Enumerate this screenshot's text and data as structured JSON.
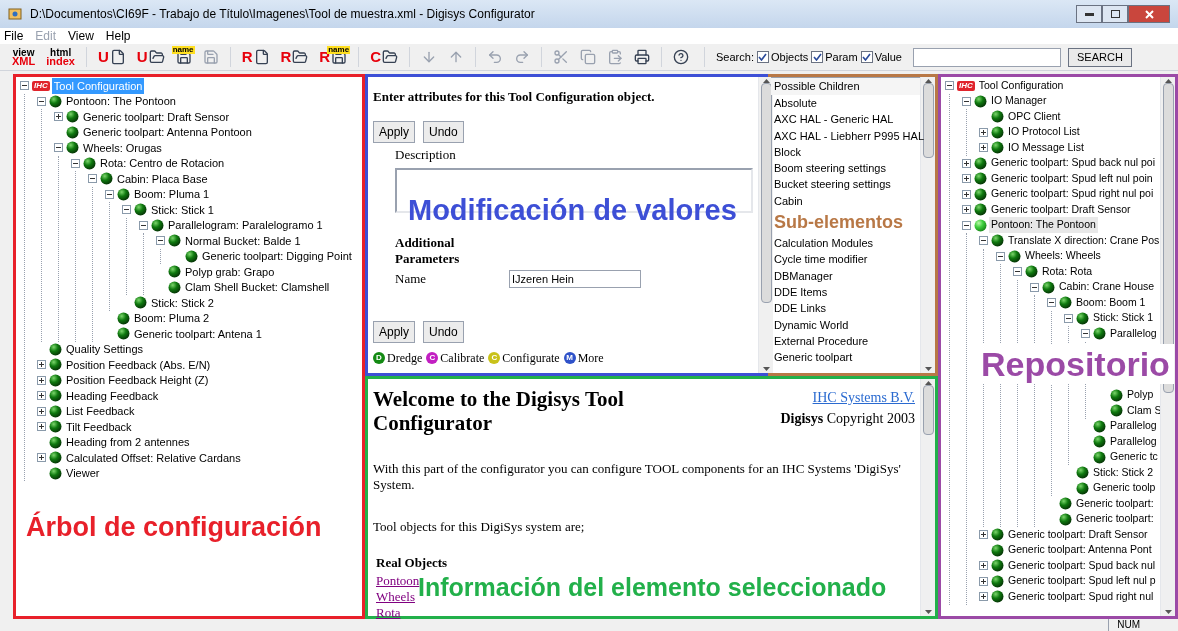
{
  "window": {
    "title": "D:\\Documentos\\CI69F - Trabajo de Título\\Imagenes\\Tool de muestra.xml - Digisys Configurator"
  },
  "menu": [
    "File",
    "Edit",
    "View",
    "Help"
  ],
  "menu_disabled": [
    false,
    true,
    false,
    false
  ],
  "toolbar": [
    {
      "kind": "stack",
      "top": "view",
      "bottom": "XML"
    },
    {
      "kind": "stack",
      "top": "html",
      "bottom": "index"
    },
    {
      "kind": "separator"
    },
    {
      "kind": "new",
      "letter": "U",
      "disabled": false
    },
    {
      "kind": "open",
      "letter": "U",
      "disabled": false
    },
    {
      "kind": "save",
      "tag": "name",
      "disabled": false
    },
    {
      "kind": "save",
      "disabled": true
    },
    {
      "kind": "separator"
    },
    {
      "kind": "new",
      "letter": "R",
      "disabled": false
    },
    {
      "kind": "open",
      "letter": "R",
      "disabled": false
    },
    {
      "kind": "save",
      "letter": "R",
      "tag": "name",
      "disabled": false
    },
    {
      "kind": "separator"
    },
    {
      "kind": "open",
      "letter": "C",
      "disabled": false
    },
    {
      "kind": "separator"
    },
    {
      "kind": "down",
      "disabled": true
    },
    {
      "kind": "up",
      "disabled": true
    },
    {
      "kind": "separator"
    },
    {
      "kind": "undo",
      "disabled": true
    },
    {
      "kind": "redo",
      "disabled": true
    },
    {
      "kind": "separator"
    },
    {
      "kind": "cut",
      "disabled": true
    },
    {
      "kind": "copy",
      "disabled": true
    },
    {
      "kind": "paste",
      "disabled": true
    },
    {
      "kind": "print",
      "disabled": false
    },
    {
      "kind": "separator"
    },
    {
      "kind": "help",
      "disabled": false
    }
  ],
  "search": {
    "label": "Search:",
    "options": [
      {
        "label": "Objects",
        "checked": true
      },
      {
        "label": "Param",
        "checked": true
      },
      {
        "label": "Value",
        "checked": true
      }
    ],
    "button": "SEARCH"
  },
  "config_tree": {
    "annotation": {
      "text": "Árbol de configuración",
      "color": "#e8202a"
    },
    "nodes": [
      {
        "label": "Tool Configuration",
        "badge": "IHC",
        "selected": true,
        "expanded": true,
        "children": [
          {
            "label": "Pontoon: The Pontoon",
            "selected": false,
            "expanded": true,
            "children": [
              {
                "label": "Generic toolpart: Draft Sensor",
                "selected": false,
                "expanded": false
              },
              {
                "label": "Generic toolpart: Antenna Pontoon",
                "selected": false
              },
              {
                "label": "Wheels: Orugas",
                "selected": false,
                "expanded": true,
                "children": [
                  {
                    "label": "Rota: Centro de Rotacion",
                    "selected": false,
                    "expanded": true,
                    "children": [
                      {
                        "label": "Cabin: Placa Base",
                        "selected": false,
                        "expanded": true,
                        "children": [
                          {
                            "label": "Boom: Pluma 1",
                            "selected": false,
                            "expanded": true,
                            "children": [
                              {
                                "label": "Stick: Stick 1",
                                "selected": false,
                                "expanded": true,
                                "children": [
                                  {
                                    "label": "Parallelogram: Paralelogramo 1",
                                    "selected": false,
                                    "expanded": true,
                                    "children": [
                                      {
                                        "label": "Normal Bucket: Balde 1",
                                        "selected": false,
                                        "expanded": true,
                                        "children": [
                                          {
                                            "label": "Generic toolpart: Digging Point",
                                            "selected": false
                                          }
                                        ]
                                      },
                                      {
                                        "label": "Polyp grab: Grapo",
                                        "selected": false
                                      },
                                      {
                                        "label": "Clam Shell Bucket: Clamshell",
                                        "selected": false
                                      }
                                    ]
                                  }
                                ]
                              },
                              {
                                "label": "Stick: Stick 2",
                                "selected": false
                              }
                            ]
                          },
                          {
                            "label": "Boom: Pluma 2",
                            "selected": false
                          },
                          {
                            "label": "Generic toolpart: Antena 1",
                            "selected": false
                          }
                        ]
                      }
                    ]
                  }
                ]
              }
            ]
          },
          {
            "label": "Quality Settings",
            "selected": false
          },
          {
            "label": "Position Feedback (Abs. E/N)",
            "selected": false,
            "expanded": false
          },
          {
            "label": "Position Feedback Height (Z)",
            "selected": false,
            "expanded": false
          },
          {
            "label": "Heading Feedback",
            "selected": false,
            "expanded": false
          },
          {
            "label": "List Feedback",
            "selected": false,
            "expanded": false
          },
          {
            "label": "Tilt Feedback",
            "selected": false,
            "expanded": false
          },
          {
            "label": "Heading from 2 antennes",
            "selected": false
          },
          {
            "label": "Calculated Offset: Relative Cardans",
            "selected": false,
            "expanded": false
          },
          {
            "label": "Viewer",
            "selected": false
          }
        ]
      }
    ]
  },
  "editor": {
    "annotation": {
      "text": "Modificación de valores",
      "color": "#3d4fd6"
    },
    "heading": "Enter attributes for this Tool Configuration object.",
    "buttons": [
      "Apply",
      "Undo"
    ],
    "description_label": "Description",
    "section": "Additional Parameters",
    "name_label": "Name",
    "name_value": "IJzeren Hein",
    "buttons_bottom": [
      "Apply",
      "Undo"
    ],
    "legend": [
      {
        "letter": "D",
        "label": "Dredge",
        "color": "#138a13"
      },
      {
        "letter": "C",
        "label": "Calibrate",
        "color": "#c21fc2"
      },
      {
        "letter": "C",
        "label": "Configurate",
        "color": "#c9c21a"
      },
      {
        "letter": "M",
        "label": "More",
        "color": "#2f52c9"
      }
    ]
  },
  "children_list": {
    "header": "Possible Children",
    "items": [
      {
        "kind": "item",
        "label": "Absolute"
      },
      {
        "kind": "item",
        "label": "AXC HAL - Generic HAL"
      },
      {
        "kind": "item",
        "label": "AXC HAL - Liebherr P995 HAL"
      },
      {
        "kind": "item",
        "label": "Block"
      },
      {
        "kind": "item",
        "label": "Boom steering settings"
      },
      {
        "kind": "item",
        "label": "Bucket steering settings"
      },
      {
        "kind": "item",
        "label": "Cabin"
      },
      {
        "kind": "annotation",
        "label": "Sub-elementos",
        "color": "#b87846"
      },
      {
        "kind": "item",
        "label": "Calculation Modules"
      },
      {
        "kind": "item",
        "label": "Cycle time modifier"
      },
      {
        "kind": "item",
        "label": "DBManager"
      },
      {
        "kind": "item",
        "label": "DDE Items"
      },
      {
        "kind": "item",
        "label": "DDE Links"
      },
      {
        "kind": "item",
        "label": "Dynamic World"
      },
      {
        "kind": "item",
        "label": "External Procedure"
      },
      {
        "kind": "item",
        "label": "Generic toolpart"
      }
    ]
  },
  "info": {
    "annotation": {
      "text": "Información del elemento seleccionado",
      "color": "#22b04a"
    },
    "title": "Welcome to the Digisys Tool Configurator",
    "company_link": "IHC Systems B.V.",
    "copyright": "**Digisys** Copyright 2003",
    "paragraphs": [
      "With this part of the configurator you can configure TOOL components for an IHC Systems 'DigiSys' System.",
      "Tool objects for this DigiSys system are;"
    ],
    "objects_heading": "Real Objects",
    "object_links": [
      "Pontoon",
      "Wheels",
      "Rota"
    ]
  },
  "repository": {
    "color": "#9b4aa6",
    "nodes": [
      {
        "kind": "node",
        "label": "Tool Configuration",
        "badge": "IHC",
        "selected": false,
        "expanded": true,
        "children": [
          {
            "kind": "node",
            "label": "IO Manager",
            "selected": false,
            "expanded": true,
            "children": [
              {
                "kind": "node",
                "label": "OPC Client",
                "selected": false
              },
              {
                "kind": "node",
                "label": "IO Protocol List",
                "selected": false,
                "expanded": false
              },
              {
                "kind": "node",
                "label": "IO Message List",
                "selected": false,
                "expanded": false
              }
            ]
          },
          {
            "kind": "node",
            "label": "Generic toolpart: Spud back nul poi",
            "selected": false,
            "expanded": false
          },
          {
            "kind": "node",
            "label": "Generic toolpart: Spud left nul poin",
            "selected": false,
            "expanded": false
          },
          {
            "kind": "node",
            "label": "Generic toolpart: Spud right nul poi",
            "selected": false,
            "expanded": false
          },
          {
            "kind": "node",
            "label": "Generic toolpart: Draft Sensor",
            "selected": false,
            "expanded": false
          },
          {
            "kind": "node",
            "label": "Pontoon: The Pontoon",
            "selected": true,
            "expanded": true,
            "children": [
              {
                "kind": "node",
                "label": "Translate X direction: Crane Pos",
                "selected": false,
                "expanded": true,
                "children": [
                  {
                    "kind": "node",
                    "label": "Wheels: Wheels",
                    "selected": false,
                    "expanded": true,
                    "children": [
                      {
                        "kind": "node",
                        "label": "Rota: Rota",
                        "selected": false,
                        "expanded": true,
                        "children": [
                          {
                            "kind": "node",
                            "label": "Cabin: Crane House",
                            "selected": false,
                            "expanded": true,
                            "children": [
                              {
                                "kind": "node",
                                "label": "Boom: Boom 1",
                                "selected": false,
                                "expanded": true,
                                "children": [
                                  {
                                    "kind": "node",
                                    "label": "Stick: Stick 1",
                                    "selected": false,
                                    "expanded": true,
                                    "children": [
                                      {
                                        "kind": "node",
                                        "label": "Parallelog",
                                        "selected": false,
                                        "expanded": true,
                                        "children": [
                                          {
                                            "kind": "annotation",
                                            "label": "Repositorio"
                                          },
                                          {
                                            "kind": "node",
                                            "label": "Polyp",
                                            "selected": false
                                          },
                                          {
                                            "kind": "node",
                                            "label": "Clam S",
                                            "selected": false
                                          }
                                        ]
                                      },
                                      {
                                        "kind": "node",
                                        "label": "Parallelog",
                                        "selected": false
                                      },
                                      {
                                        "kind": "node",
                                        "label": "Parallelog",
                                        "selected": false
                                      },
                                      {
                                        "kind": "node",
                                        "label": "Generic tc",
                                        "selected": false
                                      }
                                    ]
                                  },
                                  {
                                    "kind": "node",
                                    "label": "Stick: Stick 2",
                                    "selected": false
                                  },
                                  {
                                    "kind": "node",
                                    "label": "Generic toolp",
                                    "selected": false
                                  }
                                ]
                              },
                              {
                                "kind": "node",
                                "label": "Generic toolpart:",
                                "selected": false
                              },
                              {
                                "kind": "node",
                                "label": "Generic toolpart:",
                                "selected": false
                              }
                            ]
                          }
                        ]
                      }
                    ]
                  }
                ]
              },
              {
                "kind": "node",
                "label": "Generic toolpart: Draft Sensor",
                "selected": false,
                "expanded": false
              },
              {
                "kind": "node",
                "label": "Generic toolpart: Antenna Pont",
                "selected": false
              },
              {
                "kind": "node",
                "label": "Generic toolpart: Spud back nul",
                "selected": false,
                "expanded": false
              },
              {
                "kind": "node",
                "label": "Generic toolpart: Spud left nul p",
                "selected": false,
                "expanded": false
              },
              {
                "kind": "node",
                "label": "Generic toolpart: Spud right nul",
                "selected": false,
                "expanded": false
              }
            ]
          }
        ]
      }
    ]
  },
  "status_bar": [
    "NUM"
  ]
}
